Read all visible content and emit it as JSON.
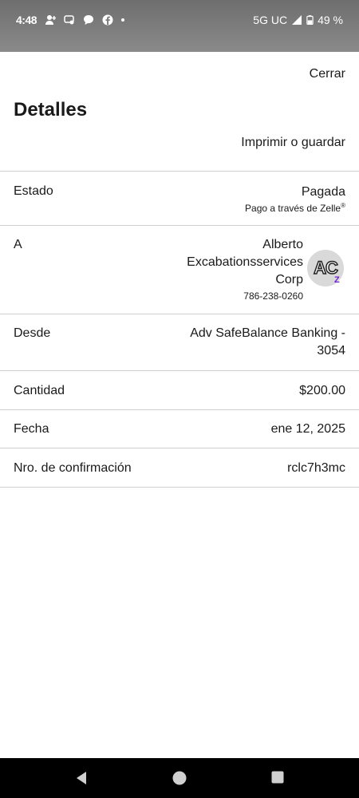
{
  "status_bar": {
    "time": "4:48",
    "network": "5G UC",
    "battery": "49 %",
    "icons": [
      "person-add-icon",
      "chat-bubble-icon",
      "message-icon",
      "facebook-icon",
      "dot-icon"
    ]
  },
  "header": {
    "close_label": "Cerrar",
    "title": "Detalles",
    "print_label": "Imprimir o guardar"
  },
  "details": {
    "status": {
      "label": "Estado",
      "value": "Pagada",
      "sub": "Pago a través de Zelle",
      "sub_mark": "®"
    },
    "recipient": {
      "label": "A",
      "name_line1": "Alberto",
      "name_line2": "Excabationsservices",
      "name_line3": "Corp",
      "phone": "786-238-0260",
      "initials": "AC",
      "badge": "Z"
    },
    "from": {
      "label": "Desde",
      "value_line1": "Adv SafeBalance Banking -",
      "value_line2": "3054"
    },
    "amount": {
      "label": "Cantidad",
      "value": "$200.00"
    },
    "date": {
      "label": "Fecha",
      "value": "ene 12, 2025"
    },
    "confirmation": {
      "label": "Nro. de confirmación",
      "value": "rclc7h3mc"
    }
  },
  "colors": {
    "zelle_purple": "#6d1ed4",
    "divider": "#cfcfcf",
    "status_bar": "#7a7a7a"
  }
}
